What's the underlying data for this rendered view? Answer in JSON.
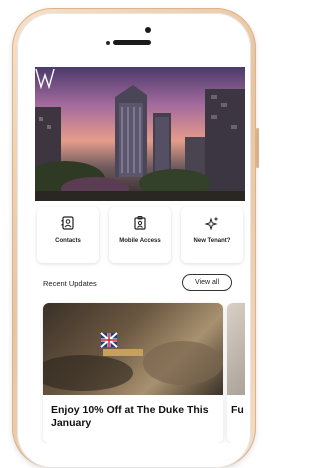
{
  "app": {
    "actions": [
      {
        "label": "Contacts",
        "icon": "contacts-icon"
      },
      {
        "label": "Mobile Access",
        "icon": "mobile-access-icon"
      },
      {
        "label": "New Tenant?",
        "icon": "sparkle-icon"
      }
    ],
    "recent_updates": {
      "title": "Recent Updates",
      "view_all_label": "View all",
      "cards": [
        {
          "title": "Enjoy 10% Off at The Duke This January"
        },
        {
          "title": "Fu Nc"
        }
      ]
    }
  },
  "colors": {
    "phone_body": "#ecc7a3",
    "text_primary": "#111111",
    "card_shadow": "rgba(0,0,0,0.12)"
  }
}
